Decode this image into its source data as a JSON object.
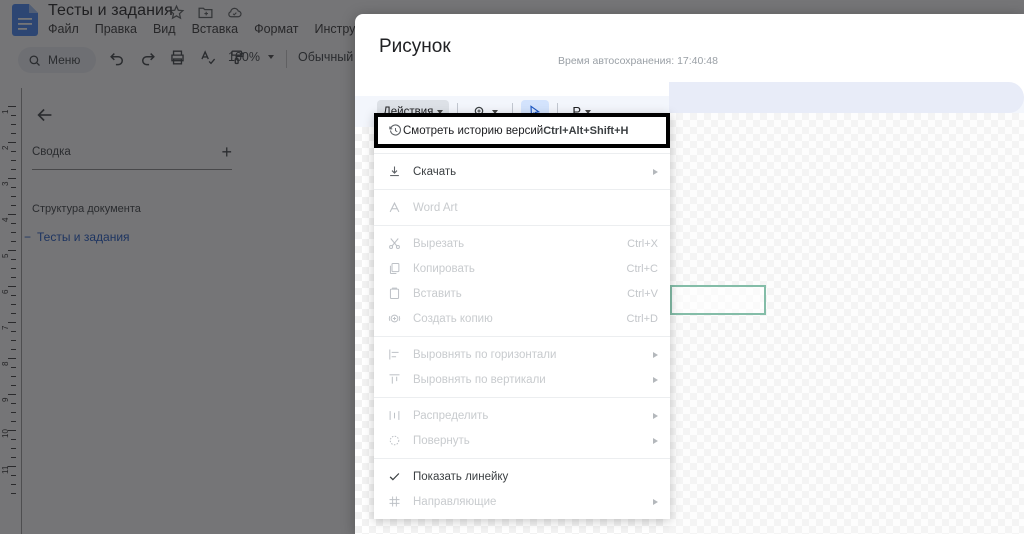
{
  "docs": {
    "title": "Тесты и задания",
    "logo_icon": "google-docs-icon",
    "title_icons": [
      "star-icon",
      "move-to-folder-icon",
      "cloud-saved-icon"
    ],
    "menubar": [
      "Файл",
      "Правка",
      "Вид",
      "Вставка",
      "Формат",
      "Инструменты"
    ],
    "toolbar": {
      "search_icon": "search-icon",
      "menu_label": "Меню",
      "icons": [
        "undo-icon",
        "redo-icon",
        "print-icon",
        "spellcheck-icon",
        "paint-format-icon"
      ],
      "zoom_value": "100%",
      "zoom_caret_icon": "chevron-down-icon",
      "style_name": "Обычный"
    },
    "ruler": {
      "numbers": [
        "1",
        "2",
        "3",
        "4",
        "5",
        "6",
        "7",
        "8",
        "9",
        "10",
        "11"
      ]
    },
    "outline": {
      "back_icon": "arrow-left-icon",
      "summary_label": "Сводка",
      "add_icon": "plus-icon",
      "structure_label": "Структура документа",
      "item_dash": "−",
      "item_label": "Тесты и задания"
    }
  },
  "dialog": {
    "title": "Рисунок",
    "autosave": "Время автосохранения: 17:40:48",
    "toolbar": {
      "actions_label": "Действия",
      "actions_caret_icon": "chevron-down-icon",
      "zoom_icon": "zoom-in-icon",
      "zoom_caret_icon": "chevron-down-icon",
      "select_icon": "cursor-arrow-icon",
      "line_label": "Р",
      "line_caret_icon": "chevron-down-icon"
    },
    "canvas": {
      "shape": "rectangle-shape",
      "shape_border_color": "#84bda8"
    }
  },
  "menu": {
    "selected": {
      "icon": "history-clock-icon",
      "label": "Смотреть историю версий",
      "accel": "Ctrl+Alt+Shift+H",
      "highlight_color": "#000000"
    },
    "groups": [
      {
        "items": [
          {
            "icon": "download-icon",
            "label": "Скачать",
            "accel": "",
            "submenu": true,
            "disabled": false
          }
        ]
      },
      {
        "items": [
          {
            "icon": "word-art-icon",
            "label": "Word Art",
            "accel": "",
            "submenu": false,
            "disabled": true
          }
        ]
      },
      {
        "items": [
          {
            "icon": "scissors-icon",
            "label": "Вырезать",
            "accel": "Ctrl+X",
            "submenu": false,
            "disabled": true
          },
          {
            "icon": "copy-icon",
            "label": "Копировать",
            "accel": "Ctrl+C",
            "submenu": false,
            "disabled": true
          },
          {
            "icon": "paste-icon",
            "label": "Вставить",
            "accel": "Ctrl+V",
            "submenu": false,
            "disabled": true
          },
          {
            "icon": "duplicate-icon",
            "label": "Создать копию",
            "accel": "Ctrl+D",
            "submenu": false,
            "disabled": true
          }
        ]
      },
      {
        "items": [
          {
            "icon": "align-horizontal-icon",
            "label": "Выровнять по горизонтали",
            "accel": "",
            "submenu": true,
            "disabled": true
          },
          {
            "icon": "align-vertical-icon",
            "label": "Выровнять по вертикали",
            "accel": "",
            "submenu": true,
            "disabled": true
          }
        ]
      },
      {
        "items": [
          {
            "icon": "distribute-icon",
            "label": "Распределить",
            "accel": "",
            "submenu": true,
            "disabled": true
          },
          {
            "icon": "rotate-icon",
            "label": "Повернуть",
            "accel": "",
            "submenu": true,
            "disabled": true
          }
        ]
      },
      {
        "items": [
          {
            "icon": "check-icon",
            "label": "Показать линейку",
            "accel": "",
            "submenu": false,
            "disabled": false
          },
          {
            "icon": "guides-grid-icon",
            "label": "Направляющие",
            "accel": "",
            "submenu": true,
            "disabled": true
          }
        ]
      }
    ]
  }
}
